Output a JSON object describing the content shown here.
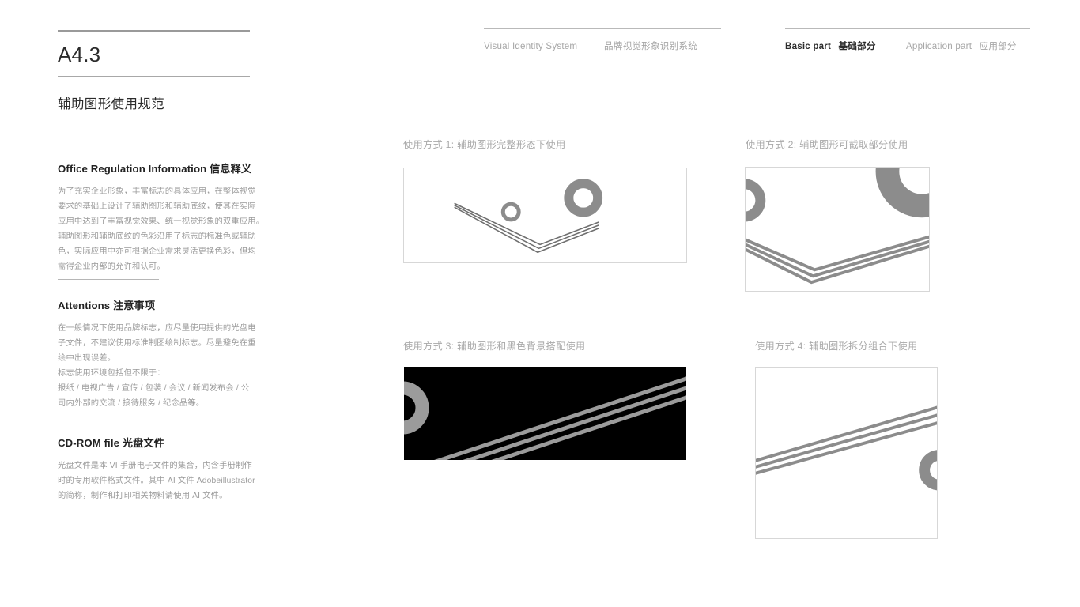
{
  "colors": {
    "graphic_gray": "#8c8c8c",
    "graphic_gray_on_black": "#9b9b9b",
    "line_gray": "#6f6f6f",
    "text_dark": "#2b2b2b",
    "text_muted": "#9b9b9b",
    "panel_border": "#d7d7d7",
    "panel_black": "#000000",
    "rule": "#9a9a9a"
  },
  "left": {
    "section_code": "A4.3",
    "page_title": "辅助图形使用规范",
    "blocks": [
      {
        "heading_en": "Office Regulation Information",
        "heading_cn": "信息释义",
        "body": "为了充实企业形象，丰富标志的具体应用，在整体视觉\n要求的基础上设计了辅助图形和辅助底纹，使其在实际\n应用中达到了丰富视觉效果、统一视觉形象的双重应用。\n辅助图形和辅助底纹的色彩沿用了标志的标准色或辅助\n色，实际应用中亦可根据企业需求灵活更换色彩，但均\n需得企业内部的允许和认可。"
      },
      {
        "heading_en": "Attentions",
        "heading_cn": "注意事项",
        "body": "在一般情况下使用品牌标志，应尽量使用提供的光盘电\n子文件，不建议使用标准制图绘制标志。尽量避免在重\n绘中出现误差。\n标志使用环境包括但不限于：\n报纸 / 电视广告 / 宣传 / 包装 / 会议 / 新闻发布会 / 公\n司内外部的交流 / 接待服务 / 纪念品等。"
      },
      {
        "heading_en": "CD-ROM file",
        "heading_cn": "光盘文件",
        "body": "光盘文件是本 VI 手册电子文件的集合，内含手册制作\n时的专用软件格式文件。其中 AI 文件 Adobeillustrator\n的简称，制作和打印相关物料请使用 AI 文件。"
      }
    ]
  },
  "header": {
    "group_left": [
      {
        "en": "Visual Identity System",
        "cn": "",
        "active": false
      },
      {
        "en": "",
        "cn": "品牌视觉形象识别系统",
        "active": false
      }
    ],
    "group_right": [
      {
        "en": "Basic part",
        "cn": "基础部分",
        "active": true
      },
      {
        "en": "Application part",
        "cn": "应用部分",
        "active": false
      }
    ]
  },
  "panels": [
    {
      "caption": "使用方式 1: 辅助图形完整形态下使用",
      "background": "white",
      "border": true
    },
    {
      "caption": "使用方式 2: 辅助图形可截取部分使用",
      "background": "white",
      "border": true
    },
    {
      "caption": "使用方式 3: 辅助图形和黑色背景搭配使用",
      "background": "black",
      "border": false
    },
    {
      "caption": "使用方式 4: 辅助图形拆分组合下使用",
      "background": "white",
      "border": true
    }
  ]
}
